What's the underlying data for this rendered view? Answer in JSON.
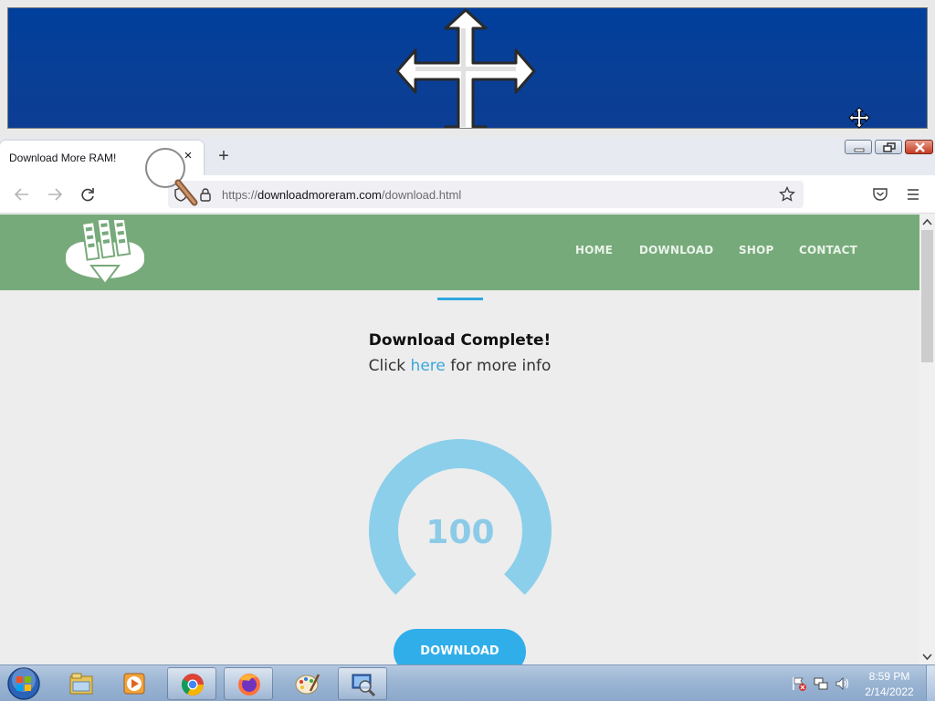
{
  "browser": {
    "tab_title": "Download More RAM!",
    "tab_close": "×",
    "new_tab": "+",
    "url": {
      "scheme": "https://",
      "host": "downloadmoreram.com",
      "path": "/download.html"
    }
  },
  "site": {
    "nav": [
      "HOME",
      "DOWNLOAD",
      "SHOP",
      "CONTACT"
    ],
    "title": "Download Complete!",
    "info_prefix": "Click ",
    "info_link": "here",
    "info_suffix": " for more info",
    "progress_value": "100",
    "progress_fraction": 1.0,
    "download_button": "DOWNLOAD",
    "accent_color": "#2faee9",
    "header_color": "#77aa7a"
  },
  "taskbar": {
    "items": [
      "start-orb",
      "file-explorer-icon",
      "media-player-icon",
      "chrome-icon",
      "firefox-icon",
      "paint-icon",
      "magnifier-icon"
    ],
    "clock_time": "8:59 PM",
    "clock_date": "2/14/2022"
  }
}
